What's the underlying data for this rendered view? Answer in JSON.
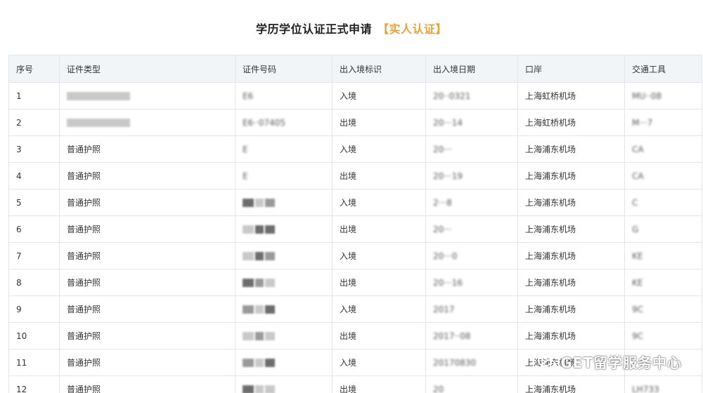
{
  "header": {
    "title": "学历学位认证正式申请",
    "tag": "【实人认证】"
  },
  "table": {
    "columns": [
      "序号",
      "证件类型",
      "证件号码",
      "出入境标识",
      "出入境日期",
      "口岸",
      "交通工具"
    ],
    "rows": [
      {
        "no": "1",
        "doc_type": "",
        "doc_no": "E6",
        "direction": "入境",
        "date": "20··0321",
        "port": "上海虹桥机场",
        "vehicle": "MU··08"
      },
      {
        "no": "2",
        "doc_type": "",
        "doc_no": "E6··07405",
        "direction": "出境",
        "date": "20···14",
        "port": "上海虹桥机场",
        "vehicle": "M···7"
      },
      {
        "no": "3",
        "doc_type": "普通护照",
        "doc_no": "E",
        "direction": "入境",
        "date": "20···",
        "port": "上海浦东机场",
        "vehicle": "CA"
      },
      {
        "no": "4",
        "doc_type": "普通护照",
        "doc_no": "E",
        "direction": "出境",
        "date": "20···19",
        "port": "上海浦东机场",
        "vehicle": "CA"
      },
      {
        "no": "5",
        "doc_type": "普通护照",
        "doc_no": "",
        "direction": "入境",
        "date": "2···8",
        "port": "上海浦东机场",
        "vehicle": "C"
      },
      {
        "no": "6",
        "doc_type": "普通护照",
        "doc_no": "",
        "direction": "出境",
        "date": "20···",
        "port": "上海浦东机场",
        "vehicle": "G"
      },
      {
        "no": "7",
        "doc_type": "普通护照",
        "doc_no": "",
        "direction": "入境",
        "date": "20···0",
        "port": "上海浦东机场",
        "vehicle": "KE"
      },
      {
        "no": "8",
        "doc_type": "普通护照",
        "doc_no": "",
        "direction": "出境",
        "date": "20···16",
        "port": "上海浦东机场",
        "vehicle": "KE"
      },
      {
        "no": "9",
        "doc_type": "普通护照",
        "doc_no": "",
        "direction": "入境",
        "date": "2017",
        "port": "上海浦东机场",
        "vehicle": "9C"
      },
      {
        "no": "10",
        "doc_type": "普通护照",
        "doc_no": "",
        "direction": "出境",
        "date": "2017··08",
        "port": "上海浦东机场",
        "vehicle": "9C"
      },
      {
        "no": "11",
        "doc_type": "普通护照",
        "doc_no": "",
        "direction": "入境",
        "date": "20170830",
        "port": "上海浦东机场",
        "vehicle": ""
      },
      {
        "no": "12",
        "doc_type": "普通护照",
        "doc_no": "",
        "direction": "出境",
        "date": "20",
        "port": "上海浦东机场",
        "vehicle": "LH733"
      }
    ]
  },
  "watermark": {
    "text": "GET留学服务中心",
    "icon": "wechat-icon"
  },
  "colors": {
    "accent": "#e8a23c",
    "header_bg": "#f2f5f8",
    "border": "#e3e6ea"
  }
}
